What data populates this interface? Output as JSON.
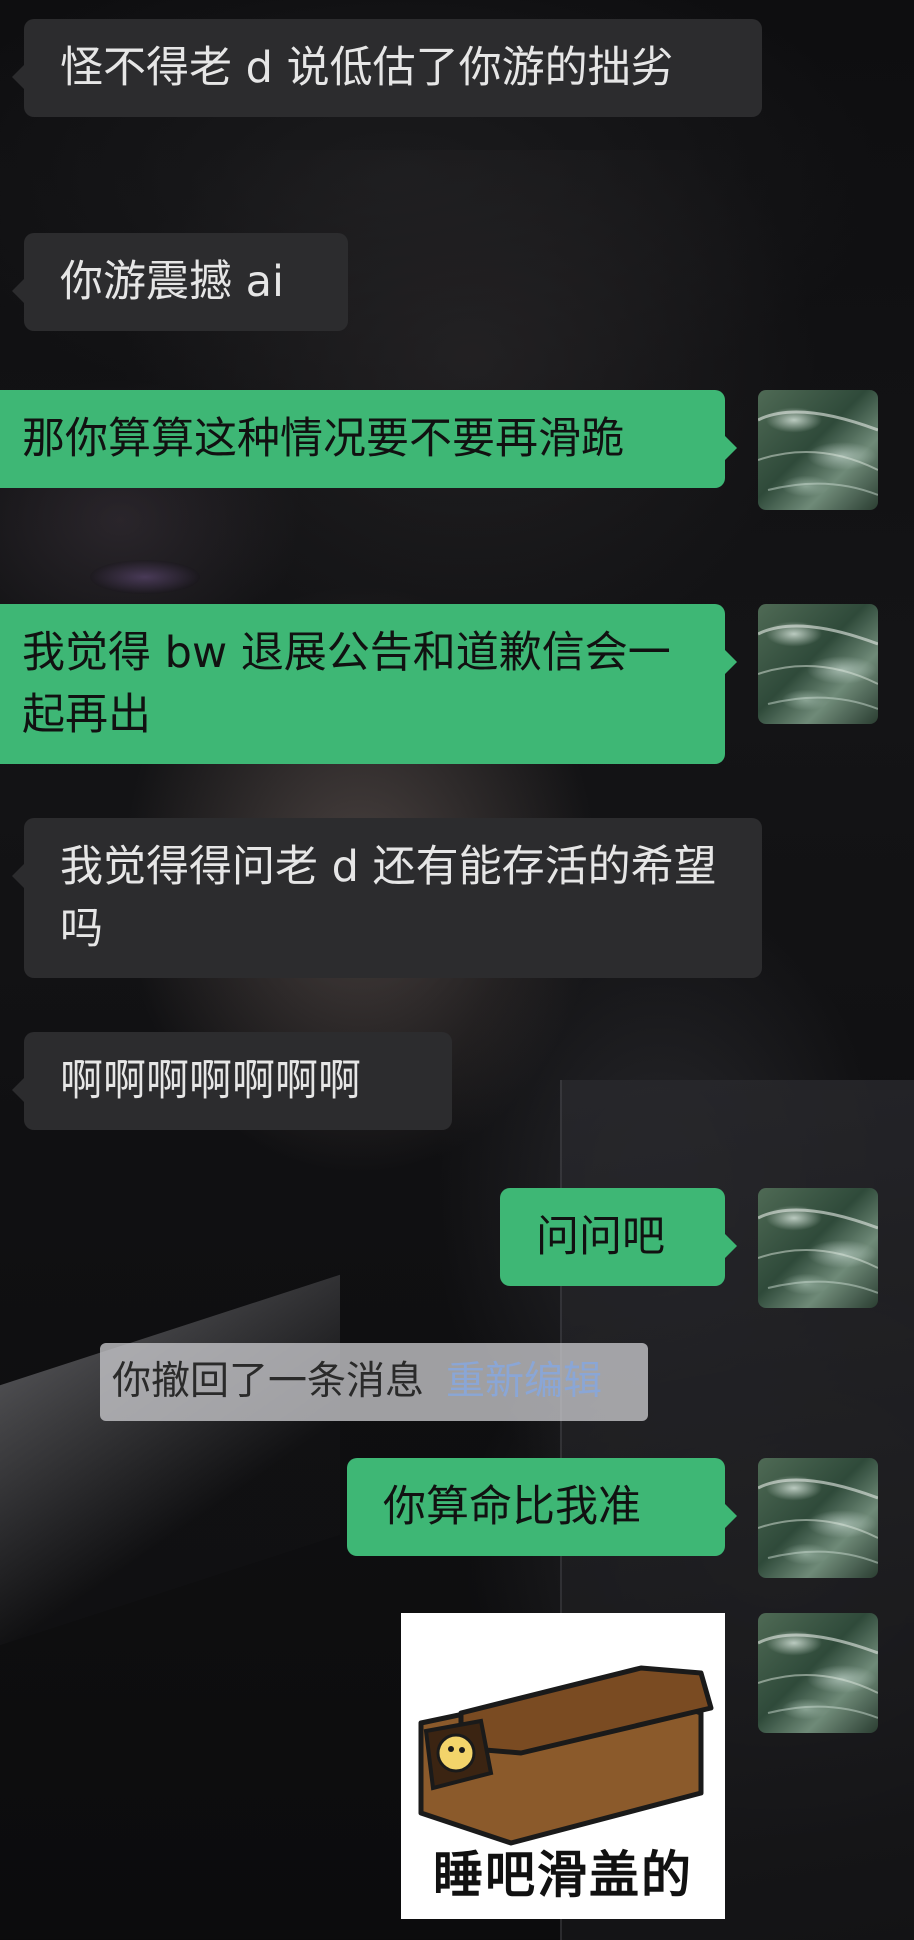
{
  "messages": [
    {
      "side": "in",
      "text": "怪不得老 d 说低估了你游的拙劣"
    },
    {
      "side": "in",
      "text": "你游震撼 ai"
    },
    {
      "side": "out",
      "text": "那你算算这种情况要不要再滑跪"
    },
    {
      "side": "out",
      "text": "我觉得 bw 退展公告和道歉信会一起再出"
    },
    {
      "side": "in",
      "text": "我觉得得问老 d 还有能存活的希望吗"
    },
    {
      "side": "in",
      "text": "啊啊啊啊啊啊啊"
    },
    {
      "side": "out",
      "text": "问问吧"
    },
    {
      "side": "out",
      "text": "你算命比我准"
    }
  ],
  "recall_notice": {
    "text": "你撤回了一条消息",
    "action": "重新编辑"
  },
  "sticker": {
    "caption": "睡吧滑盖的"
  },
  "avatar_icon": "landscape-avatar-icon",
  "colors": {
    "incoming_bubble": "#2c2c2e",
    "outgoing_bubble": "#3eb775",
    "recall_link": "#8aa6d6"
  }
}
